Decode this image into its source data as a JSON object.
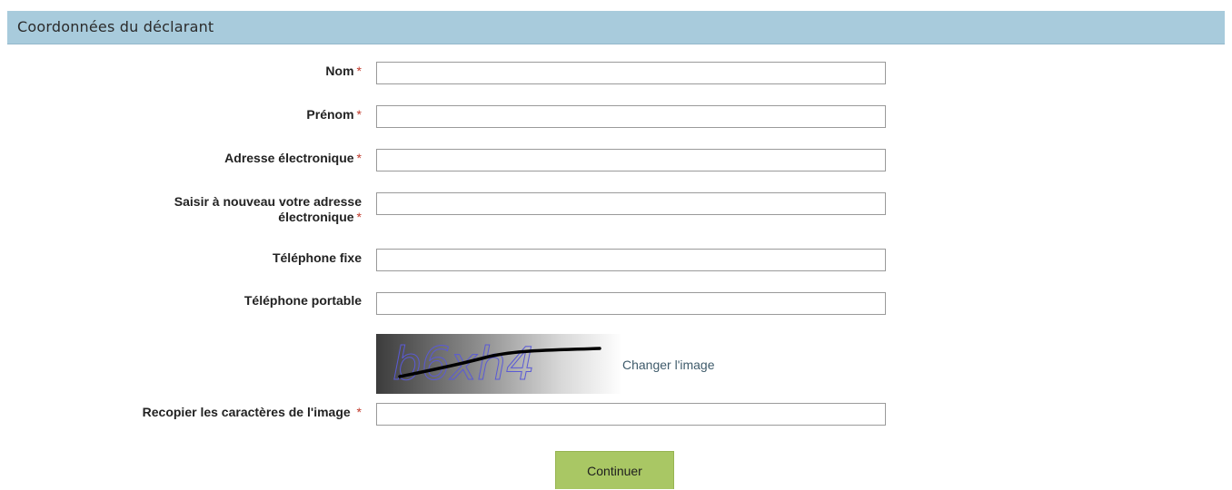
{
  "section": {
    "title": "Coordonnées du déclarant"
  },
  "form": {
    "required_marker": "*",
    "fields": [
      {
        "label": "Nom",
        "required": true,
        "value": ""
      },
      {
        "label": "Prénom",
        "required": true,
        "value": ""
      },
      {
        "label": "Adresse électronique",
        "required": true,
        "value": ""
      },
      {
        "label_line1": "Saisir à nouveau votre adresse",
        "label_line2": "électronique",
        "required": true,
        "value": ""
      },
      {
        "label": "Téléphone fixe",
        "required": false,
        "value": ""
      },
      {
        "label": "Téléphone portable",
        "required": false,
        "value": ""
      }
    ],
    "captcha": {
      "image_text": "b6xh4",
      "change_link": "Changer l'image",
      "input_label": "Recopier les caractères de l'image",
      "input_required": true,
      "input_value": ""
    },
    "submit_label": "Continuer"
  },
  "colors": {
    "header_bg": "#a8cbdc",
    "required": "#c0392b",
    "button_bg": "#a9c764",
    "link": "#3f5b6b"
  }
}
